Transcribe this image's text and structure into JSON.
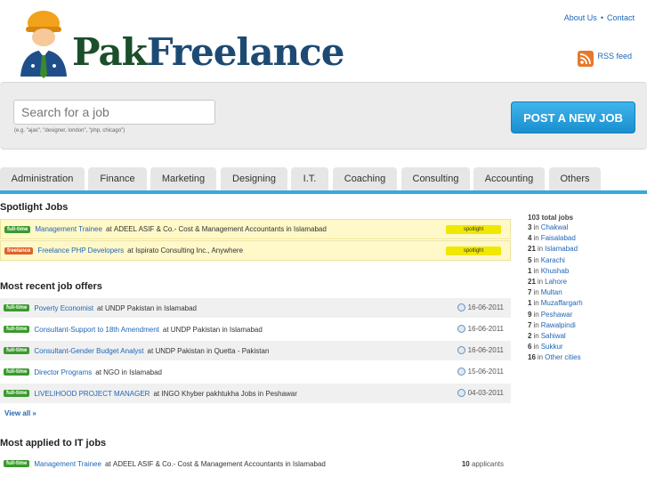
{
  "header": {
    "logo_part1": "Pak",
    "logo_part2": "Freelance",
    "about_link": "About Us",
    "separator": "•",
    "contact_link": "Contact",
    "rss_label": "RSS feed"
  },
  "search": {
    "placeholder": "Search for a job",
    "hint": "(e.g. \"ajax\", \"designer, london\", \"php, chicago\")",
    "post_button": "POST A NEW JOB"
  },
  "tabs": [
    "Administration",
    "Finance",
    "Marketing",
    "Designing",
    "I.T.",
    "Coaching",
    "Consulting",
    "Accounting",
    "Others"
  ],
  "spotlight": {
    "title": "Spotlight Jobs",
    "tag": "spotlight",
    "jobs": [
      {
        "badge": "full-time",
        "title": "Management Trainee",
        "at": "at",
        "company": "ADEEL ASIF & Co.- Cost & Management Accountants",
        "in": "in",
        "location": "Islamabad"
      },
      {
        "badge": "freelance",
        "title": "Freelance PHP Developers",
        "at": "at",
        "company": "Ispirato Consulting Inc., Anywhere",
        "in": "",
        "location": ""
      }
    ]
  },
  "recent": {
    "title": "Most recent job offers",
    "jobs": [
      {
        "badge": "full-time",
        "title": "Poverty Economist",
        "at": "at",
        "company": "UNDP Pakistan",
        "in": "in",
        "location": "Islamabad",
        "date": "16-06-2011"
      },
      {
        "badge": "full-time",
        "title": "Consultant-Support to 18th Amendment",
        "at": "at",
        "company": "UNDP Pakistan",
        "in": "in",
        "location": "Islamabad",
        "date": "16-06-2011"
      },
      {
        "badge": "full-time",
        "title": "Consultant-Gender Budget Analyst",
        "at": "at",
        "company": "UNDP Pakistan",
        "in": "in",
        "location": "Quetta - Pakistan",
        "date": "16-06-2011"
      },
      {
        "badge": "full-time",
        "title": "Director Programs",
        "at": "at",
        "company": "NGO",
        "in": "in",
        "location": "Islamabad",
        "date": "15-06-2011"
      },
      {
        "badge": "full-time",
        "title": "LIVELIHOOD PROJECT MANAGER",
        "at": "at",
        "company": "INGO Khyber pakhtukha Jobs",
        "in": "in",
        "location": "Peshawar",
        "date": "04-03-2011"
      }
    ],
    "view_all": "View all »"
  },
  "most_applied": {
    "title": "Most applied to IT jobs",
    "jobs": [
      {
        "badge": "full-time",
        "title": "Management Trainee",
        "at": "at",
        "company": "ADEEL ASIF & Co.- Cost & Management Accountants",
        "in": "in",
        "location": "Islamabad",
        "count": "10",
        "count_label": "applicants"
      }
    ]
  },
  "cities": {
    "total": "103 total jobs",
    "in_word": "in",
    "rows": [
      {
        "count": "3",
        "city": "Chakwal"
      },
      {
        "count": "4",
        "city": "Faisalabad"
      },
      {
        "count": "21",
        "city": "Islamabad"
      },
      {
        "count": "5",
        "city": "Karachi"
      },
      {
        "count": "1",
        "city": "Khushab"
      },
      {
        "count": "21",
        "city": "Lahore"
      },
      {
        "count": "7",
        "city": "Multan"
      },
      {
        "count": "1",
        "city": "Muzaffargarh"
      },
      {
        "count": "9",
        "city": "Peshawar"
      },
      {
        "count": "7",
        "city": "Rawalpindi"
      },
      {
        "count": "2",
        "city": "Sahiwal"
      },
      {
        "count": "6",
        "city": "Sukkur"
      },
      {
        "count": "16",
        "city": "Other cities"
      }
    ]
  },
  "colors": {
    "accent": "#36a9e0",
    "badge_fulltime": "#3a9a2c",
    "badge_freelance": "#e0622a",
    "spotlight_bg": "#fff8c8",
    "spotlight_tag": "#f0e800"
  }
}
